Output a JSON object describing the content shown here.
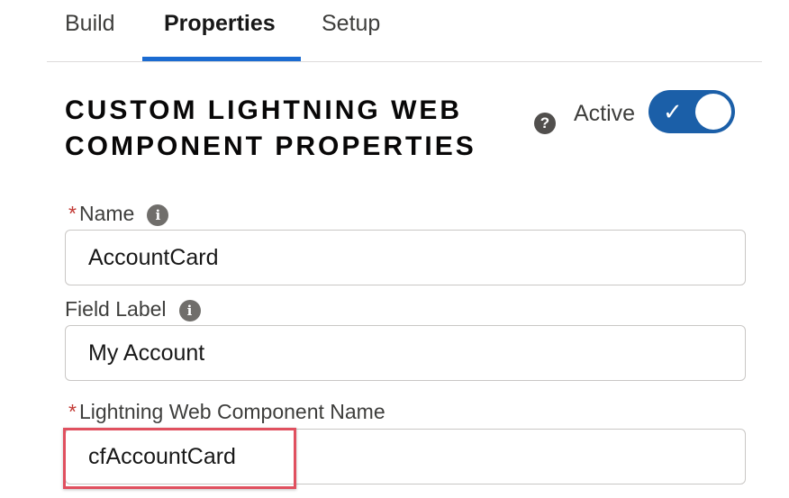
{
  "tabs": [
    {
      "label": "Build"
    },
    {
      "label": "Properties"
    },
    {
      "label": "Setup"
    }
  ],
  "section_title": "CUSTOM LIGHTNING WEB COMPONENT PROPERTIES",
  "help_icon_glyph": "?",
  "active": {
    "label": "Active",
    "checked": true
  },
  "fields": {
    "name": {
      "label": "Name",
      "required_marker": "*",
      "value": "AccountCard"
    },
    "field_label": {
      "label": "Field Label",
      "value": "My Account"
    },
    "lwc_name": {
      "label": "Lightning Web Component Name",
      "required_marker": "*",
      "value": "cfAccountCard"
    }
  },
  "info_icon_glyph": "i",
  "colors": {
    "accent": "#1b6bd1",
    "toggle": "#1b5fa8",
    "required": "#c23934",
    "highlight": "#e0505f"
  }
}
